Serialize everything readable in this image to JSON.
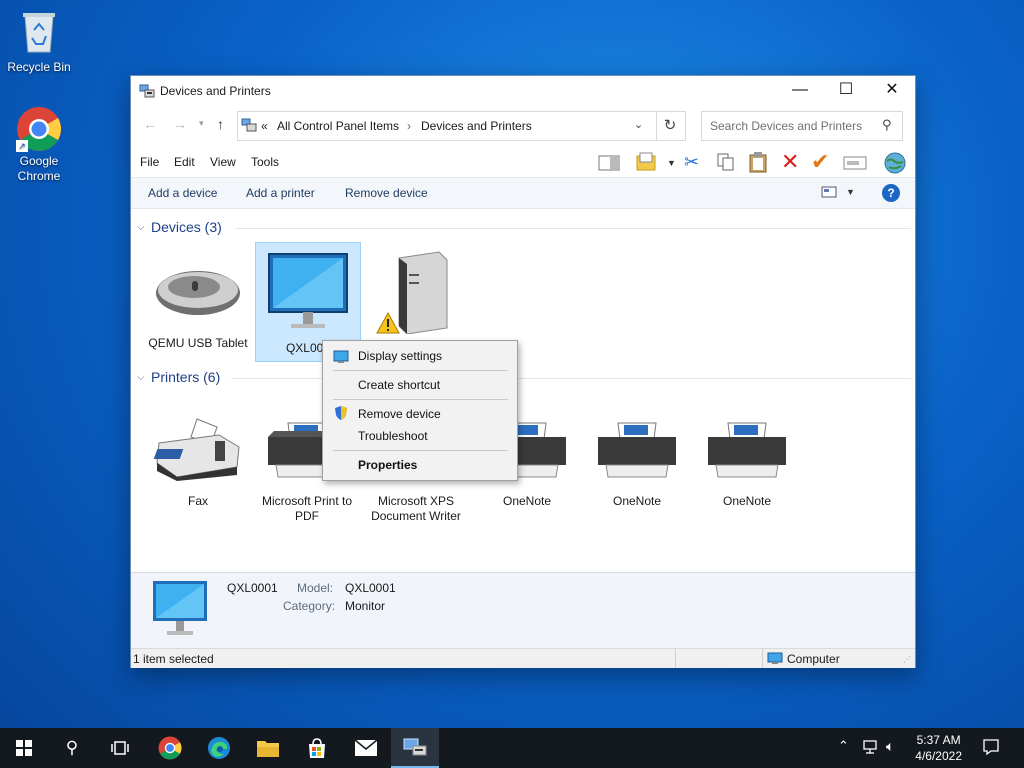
{
  "desktop": {
    "recycle_bin": "Recycle Bin",
    "chrome": "Google Chrome"
  },
  "window": {
    "title": "Devices and Printers",
    "minimize": "—",
    "maximize": "☐",
    "close": "✕"
  },
  "address": {
    "overflow": "«",
    "crumb1": "All Control Panel Items",
    "sep": "›",
    "crumb2": "Devices and Printers",
    "search_placeholder": "Search Devices and Printers"
  },
  "menu": {
    "file": "File",
    "edit": "Edit",
    "view": "View",
    "tools": "Tools"
  },
  "commands": {
    "add_device": "Add a device",
    "add_printer": "Add a printer",
    "remove_device": "Remove device"
  },
  "groups": {
    "devices": "Devices (3)",
    "printers": "Printers (6)"
  },
  "devices": [
    {
      "label": "QEMU USB Tablet"
    },
    {
      "label": "QXL000"
    },
    {
      "label": ""
    }
  ],
  "printers": [
    {
      "label": "Fax"
    },
    {
      "label": "Microsoft Print to PDF"
    },
    {
      "label": "Microsoft XPS Document Writer"
    },
    {
      "label": "OneNote"
    },
    {
      "label": "OneNote"
    },
    {
      "label": "OneNote"
    }
  ],
  "context_menu": {
    "display_settings": "Display settings",
    "create_shortcut": "Create shortcut",
    "remove_device": "Remove device",
    "troubleshoot": "Troubleshoot",
    "properties": "Properties"
  },
  "details": {
    "name": "QXL0001",
    "model_label": "Model:",
    "model_value": "QXL0001",
    "category_label": "Category:",
    "category_value": "Monitor"
  },
  "status": {
    "selected": "1 item selected",
    "location": "Computer"
  },
  "clock": {
    "time": "5:37 AM",
    "date": "4/6/2022"
  },
  "colors": {
    "accent": "#0078d7",
    "selection": "#cce8ff",
    "remove_red": "#d81e1e"
  }
}
